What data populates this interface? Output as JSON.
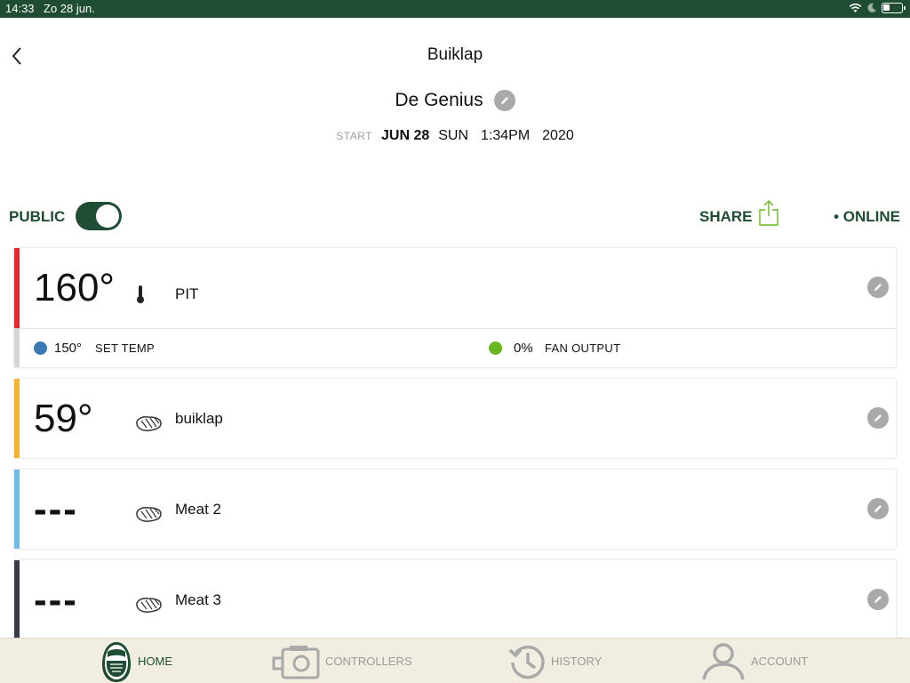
{
  "status_bar": {
    "time": "14:33",
    "date": "Zo 28 jun."
  },
  "header": {
    "title": "Buiklap",
    "cook_name": "De Genius"
  },
  "start": {
    "label": "START",
    "date": "JUN 28",
    "day": "SUN",
    "time": "1:34PM",
    "year": "2020"
  },
  "controls": {
    "public_label": "PUBLIC",
    "public_enabled": true,
    "share_label": "SHARE",
    "online_label": "• ONLINE"
  },
  "probes": [
    {
      "temp": "160°",
      "name": "PIT",
      "icon": "thermometer-icon",
      "color": "#e8262b",
      "set_temp": {
        "value": "150°",
        "label": "SET TEMP",
        "color": "#3d78b4"
      },
      "fan": {
        "value": "0%",
        "label": "FAN OUTPUT",
        "color": "#6ab820"
      }
    },
    {
      "temp": "59°",
      "name": "buiklap",
      "icon": "steak-icon",
      "color": "#f2b52d"
    },
    {
      "temp": "---",
      "name": "Meat 2",
      "icon": "steak-icon",
      "color": "#6dbbe6"
    },
    {
      "temp": "---",
      "name": "Meat 3",
      "icon": "steak-icon",
      "color": "#3a3a44"
    }
  ],
  "tabs": [
    {
      "label": "HOME",
      "icon": "egg-logo-icon",
      "active": true
    },
    {
      "label": "CONTROLLERS",
      "icon": "controller-icon",
      "active": false
    },
    {
      "label": "HISTORY",
      "icon": "history-icon",
      "active": false
    },
    {
      "label": "ACCOUNT",
      "icon": "account-icon",
      "active": false
    }
  ],
  "colors": {
    "brand_green": "#1f4d33",
    "share_icon_green": "#6ab820",
    "tabbar_bg": "#f1eee1"
  }
}
